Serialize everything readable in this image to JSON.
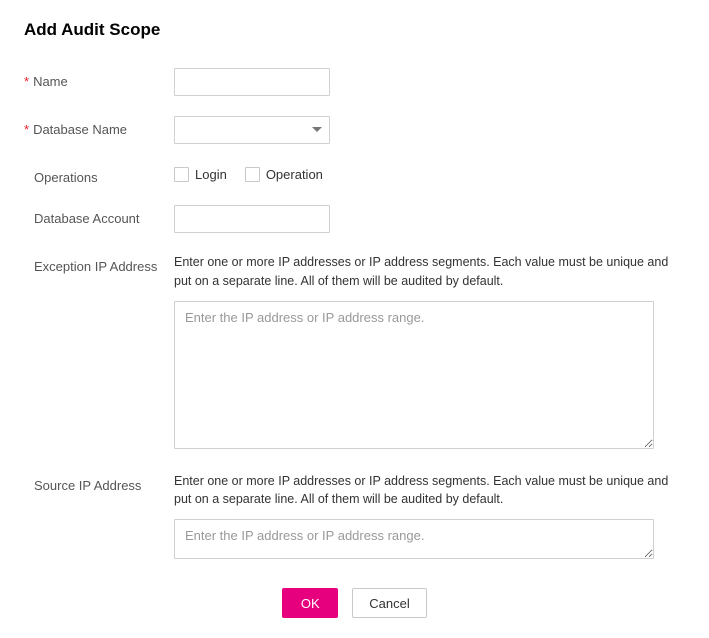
{
  "title": "Add Audit Scope",
  "fields": {
    "name": {
      "label": "Name",
      "required": true,
      "value": ""
    },
    "databaseName": {
      "label": "Database Name",
      "required": true,
      "value": ""
    },
    "operations": {
      "label": "Operations",
      "options": {
        "login": {
          "label": "Login",
          "checked": false
        },
        "operation": {
          "label": "Operation",
          "checked": false
        }
      }
    },
    "databaseAccount": {
      "label": "Database Account",
      "value": ""
    },
    "exceptionIp": {
      "label": "Exception IP Address",
      "helper": "Enter one or more IP addresses or IP address segments. Each value must be unique and put on a separate line. All of them will be audited by default.",
      "placeholder": "Enter the IP address or IP address range.",
      "value": ""
    },
    "sourceIp": {
      "label": "Source IP Address",
      "helper": "Enter one or more IP addresses or IP address segments. Each value must be unique and put on a separate line. All of them will be audited by default.",
      "placeholder": "Enter the IP address or IP address range.",
      "value": ""
    }
  },
  "buttons": {
    "ok": "OK",
    "cancel": "Cancel"
  }
}
